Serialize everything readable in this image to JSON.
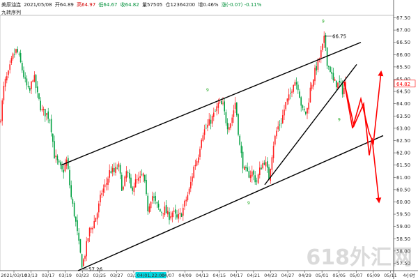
{
  "header": {
    "symbol": "美原油连",
    "date": "2021/05/08",
    "open": "开64.89",
    "high": "高64.97",
    "low": "低64.67",
    "close": "收64.82",
    "volume": "量57505",
    "oi": "仓12364200",
    "oi_change": "增0.46%",
    "change": "涨(-0.07) -0.11%",
    "indicator": "九转序列"
  },
  "watermark": "618外汇网",
  "colors": {
    "up": "#ff2020",
    "down": "#00a040",
    "line": "#000000",
    "arrow": "#ff0000",
    "axis": "#444444",
    "highlight": "#00d7e0"
  },
  "chart_data": {
    "type": "candlestick",
    "ylim": [
      57.2,
      67.6
    ],
    "y_ticks": [
      57.5,
      58.0,
      58.5,
      59.0,
      59.5,
      60.0,
      60.5,
      61.0,
      61.5,
      62.0,
      62.5,
      63.0,
      63.5,
      64.0,
      64.5,
      65.0,
      65.5,
      66.0,
      66.5,
      67.0,
      67.5
    ],
    "y_tick_labels": [
      "57.50",
      "58.00",
      "58.50",
      "59.00",
      "59.50",
      "60.00",
      "60.50",
      "61.00",
      "61.50",
      "62.00",
      "62.50",
      "63.00",
      "63.50",
      "64.00",
      "64.50",
      "65.00",
      "65.50",
      "66.00",
      "66.50",
      "67.00",
      "67.50"
    ],
    "x_tick_labels": [
      "2021/03/10",
      "03/13",
      "03/17",
      "03/19",
      "03/23",
      "03/25",
      "03/27",
      "03/31",
      "04/01,22:00",
      "04/07",
      "04/09",
      "04/13",
      "04/15",
      "04/17",
      "04/21",
      "04/23",
      "04/27",
      "04/29",
      "05/01",
      "05/05",
      "05/07",
      "05/09",
      "05/11",
      "4小时"
    ],
    "highlighted_x_label": "04/01,22:00",
    "last_price": "64.82",
    "last_price_value": 64.82,
    "annotations": [
      {
        "text": "66.75",
        "price": 66.75
      },
      {
        "text": "57.26",
        "price": 57.26
      }
    ],
    "series_points": [
      [
        0,
        63.2
      ],
      [
        6,
        64.8
      ],
      [
        12,
        65.2
      ],
      [
        18,
        65.9
      ],
      [
        24,
        66.2
      ],
      [
        30,
        65.6
      ],
      [
        36,
        64.9
      ],
      [
        42,
        64.4
      ],
      [
        48,
        65.2
      ],
      [
        54,
        64.3
      ],
      [
        60,
        63.7
      ],
      [
        66,
        63.6
      ],
      [
        72,
        63.4
      ],
      [
        78,
        61.9
      ],
      [
        84,
        61.5
      ],
      [
        90,
        61.2
      ],
      [
        96,
        61.7
      ],
      [
        102,
        60.2
      ],
      [
        108,
        59.3
      ],
      [
        114,
        58.1
      ],
      [
        118,
        57.4
      ],
      [
        122,
        57.9
      ],
      [
        128,
        58.8
      ],
      [
        134,
        59.1
      ],
      [
        140,
        59.6
      ],
      [
        146,
        60.4
      ],
      [
        152,
        60.7
      ],
      [
        158,
        61.3
      ],
      [
        164,
        61.2
      ],
      [
        170,
        61.5
      ],
      [
        176,
        60.4
      ],
      [
        182,
        61.3
      ],
      [
        188,
        60.5
      ],
      [
        194,
        60.8
      ],
      [
        200,
        60.9
      ],
      [
        206,
        61.1
      ],
      [
        212,
        59.7
      ],
      [
        218,
        60.3
      ],
      [
        224,
        59.9
      ],
      [
        230,
        59.6
      ],
      [
        236,
        59.7
      ],
      [
        242,
        59.4
      ],
      [
        248,
        59.6
      ],
      [
        254,
        59.3
      ],
      [
        260,
        59.5
      ],
      [
        266,
        60.0
      ],
      [
        272,
        60.5
      ],
      [
        278,
        61.4
      ],
      [
        284,
        61.8
      ],
      [
        290,
        62.8
      ],
      [
        296,
        63.0
      ],
      [
        302,
        63.3
      ],
      [
        308,
        63.6
      ],
      [
        314,
        64.0
      ],
      [
        320,
        63.9
      ],
      [
        326,
        63.1
      ],
      [
        332,
        63.3
      ],
      [
        338,
        64.1
      ],
      [
        344,
        62.3
      ],
      [
        350,
        61.3
      ],
      [
        356,
        61.1
      ],
      [
        362,
        61.2
      ],
      [
        368,
        60.8
      ],
      [
        374,
        61.4
      ],
      [
        380,
        61.7
      ],
      [
        386,
        61.0
      ],
      [
        392,
        62.3
      ],
      [
        398,
        63.0
      ],
      [
        404,
        63.3
      ],
      [
        410,
        64.0
      ],
      [
        416,
        64.3
      ],
      [
        422,
        65.0
      ],
      [
        428,
        64.7
      ],
      [
        434,
        63.7
      ],
      [
        440,
        63.6
      ],
      [
        446,
        64.7
      ],
      [
        452,
        65.3
      ],
      [
        458,
        65.8
      ],
      [
        462,
        66.2
      ],
      [
        466,
        66.7
      ],
      [
        470,
        65.6
      ],
      [
        474,
        65.4
      ],
      [
        478,
        64.9
      ],
      [
        484,
        64.8
      ],
      [
        488,
        64.8
      ],
      [
        492,
        64.5
      ],
      [
        496,
        64.82
      ]
    ],
    "trend_lines": [
      {
        "name": "channel-upper",
        "from": [
          88,
          61.5
        ],
        "to": [
          518,
          66.5
        ]
      },
      {
        "name": "channel-lower",
        "from": [
          112,
          57.2
        ],
        "to": [
          550,
          62.7
        ]
      },
      {
        "name": "inner-support",
        "from": [
          380,
          60.7
        ],
        "to": [
          512,
          65.6
        ]
      }
    ],
    "forecast_paths": [
      {
        "name": "path-down",
        "points": [
          [
            494,
            64.9
          ],
          [
            508,
            63.1
          ],
          [
            522,
            64.0
          ],
          [
            530,
            61.9
          ],
          [
            534,
            62.6
          ],
          [
            544,
            60.0
          ]
        ]
      },
      {
        "name": "path-up",
        "points": [
          [
            494,
            64.9
          ],
          [
            506,
            63.0
          ],
          [
            518,
            64.2
          ],
          [
            530,
            62.8
          ],
          [
            536,
            62.4
          ],
          [
            547,
            65.3
          ]
        ]
      }
    ],
    "td_marks": [
      {
        "label": "9",
        "x": 296,
        "price": 64.5
      },
      {
        "label": "9",
        "x": 462,
        "price": 67.3
      },
      {
        "label": "9",
        "x": 355,
        "price": 59.9
      },
      {
        "label": "9",
        "x": 485,
        "price": 63.3
      }
    ]
  }
}
